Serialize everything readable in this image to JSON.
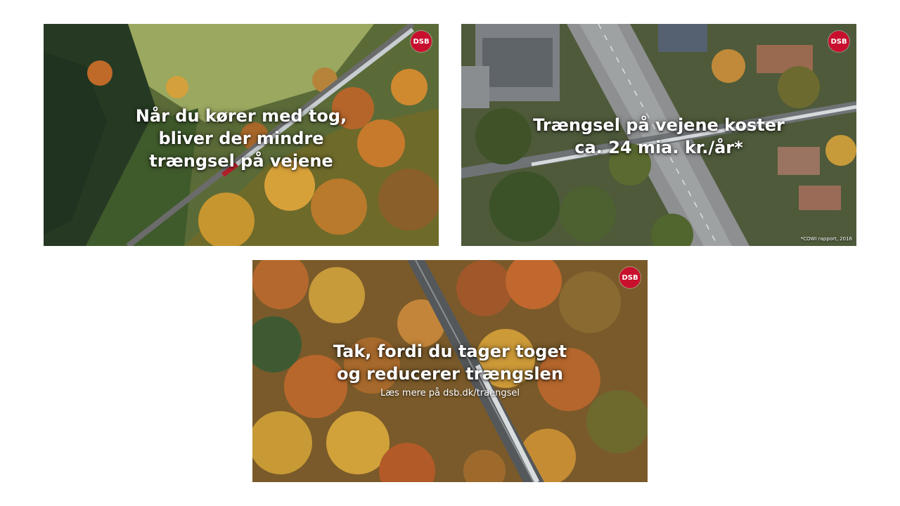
{
  "slides": [
    {
      "logo": "DSB",
      "headline": [
        "Når du kører med tog,",
        "bliver der mindre",
        "trængsel på vejene"
      ]
    },
    {
      "logo": "DSB",
      "headline": [
        "Trængsel på vejene koster",
        "ca. 24 mia. kr./år*"
      ],
      "footnote": "*COWI rapport, 2016"
    },
    {
      "logo": "DSB",
      "headline": [
        "Tak, fordi du tager toget",
        "og reducerer trængslen"
      ],
      "subline": "Læs mere på dsb.dk/traengsel"
    }
  ],
  "colors": {
    "brand_red": "#c8102e",
    "text": "#ffffff"
  }
}
